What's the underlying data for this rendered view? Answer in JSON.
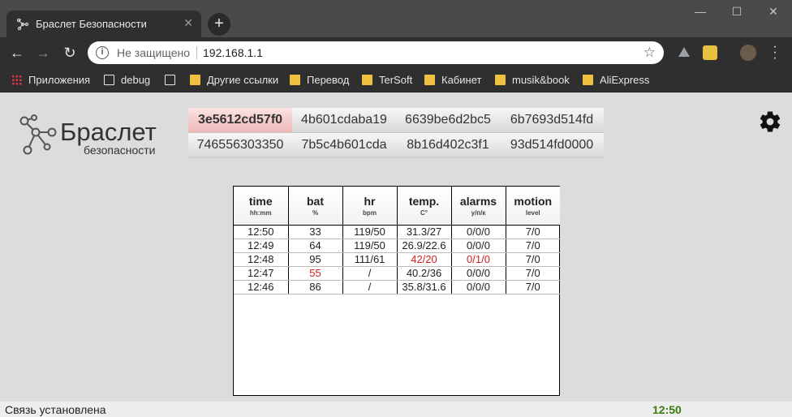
{
  "browser": {
    "tab_title": "Браслет Безопасности",
    "tab_close": "✕",
    "new_tab": "+",
    "window_minimize": "—",
    "window_maximize": "☐",
    "window_close": "✕",
    "security_label": "Не защищено",
    "url": "192.168.1.1",
    "bookmarks": [
      {
        "label": "Приложения",
        "icon": "apps-grid-icon"
      },
      {
        "label": "debug",
        "icon": "page-icon"
      },
      {
        "label": "",
        "icon": "page-icon"
      },
      {
        "label": "Другие ссылки",
        "icon": "folder-icon"
      },
      {
        "label": "Перевод",
        "icon": "folder-icon"
      },
      {
        "label": "TerSoft",
        "icon": "folder-icon"
      },
      {
        "label": "Кабинет",
        "icon": "folder-icon"
      },
      {
        "label": "musik&book",
        "icon": "folder-icon"
      },
      {
        "label": "AliExpress",
        "icon": "folder-icon"
      }
    ]
  },
  "app": {
    "logo_title": "Браслет",
    "logo_subtitle": "безопасности",
    "devices": [
      "3e5612cd57f0",
      "4b601cdaba19",
      "6639be6d2bc5",
      "6b7693d514fd",
      "746556303350",
      "7b5c4b601cda",
      "8b16d402c3f1",
      "93d514fd0000"
    ],
    "active_device": "3e5612cd57f0",
    "table": {
      "columns": [
        {
          "name": "time",
          "unit": "hh:mm"
        },
        {
          "name": "bat",
          "unit": "%"
        },
        {
          "name": "hr",
          "unit": "bpm"
        },
        {
          "name": "temp.",
          "unit": "C°"
        },
        {
          "name": "alarms",
          "unit": "у/п/к"
        },
        {
          "name": "motion",
          "unit": "level"
        }
      ],
      "rows": [
        [
          "12:50",
          "33",
          "119/50",
          "31.3/27",
          "0/0/0",
          "7/0"
        ],
        [
          "12:49",
          "64",
          "119/50",
          "26.9/22.6",
          "0/0/0",
          "7/0"
        ],
        [
          "12:48",
          "95",
          "111/61",
          "42/20",
          "0/1/0",
          "7/0"
        ],
        [
          "12:47",
          "55",
          "/",
          "40.2/36",
          "0/0/0",
          "7/0"
        ],
        [
          "12:46",
          "86",
          "/",
          "35.8/31.6",
          "0/0/0",
          "7/0"
        ]
      ],
      "alert_color": "#d21f1f"
    },
    "status_text": "Связь установлена",
    "status_time": "12:50",
    "status_time_color": "#3a7a10"
  }
}
